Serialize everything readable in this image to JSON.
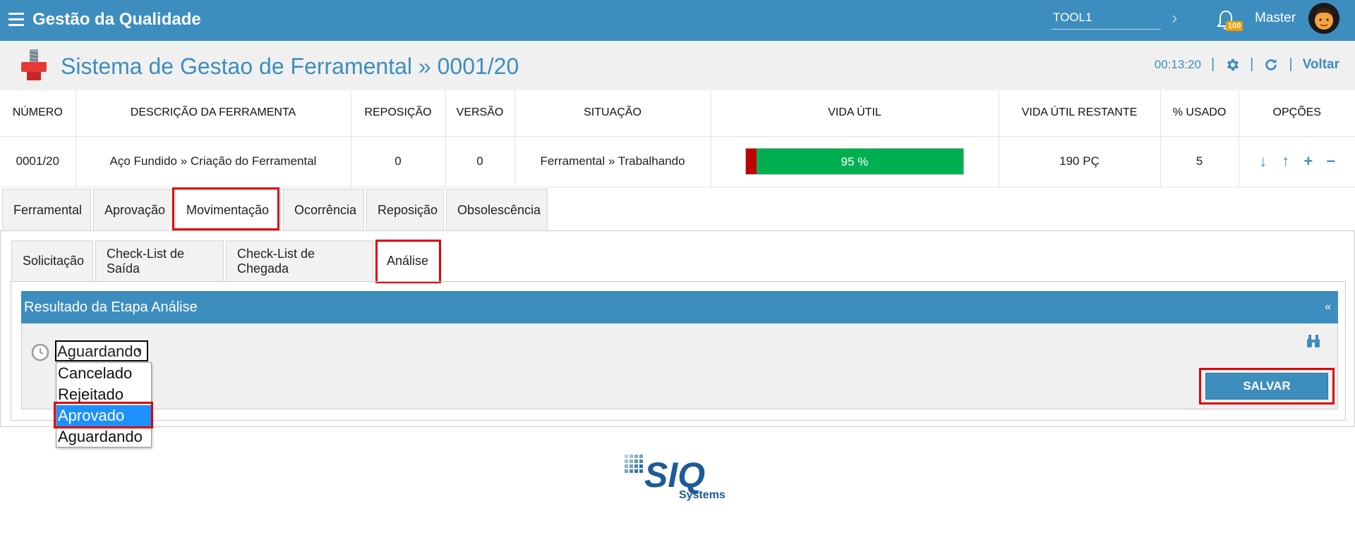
{
  "app": {
    "title": "Gestão da Qualidade"
  },
  "topbar": {
    "search_value": "TOOL1",
    "notifications_count": "100",
    "user_name": "Master"
  },
  "header": {
    "title": "Sistema de Gestao de Ferramental » 0001/20",
    "timer": "00:13:20",
    "back_label": "Voltar"
  },
  "table": {
    "headers": {
      "numero": "NÚMERO",
      "descricao": "DESCRIÇÃO DA FERRAMENTA",
      "reposicao": "REPOSIÇÃO",
      "versao": "VERSÃO",
      "situacao": "SITUAÇÃO",
      "vida_util": "VIDA ÚTIL",
      "vida_restante": "VIDA ÚTIL RESTANTE",
      "usado": "% USADO",
      "opcoes": "OPÇÕES"
    },
    "row": {
      "numero": "0001/20",
      "descricao": "Aço Fundido » Criação do Ferramental",
      "reposicao": "0",
      "versao": "0",
      "situacao": "Ferramental » Trabalhando",
      "vida_util_label": "95 %",
      "vida_util_percent": 95,
      "vida_restante": "190 PÇ",
      "usado": "5"
    },
    "colors": {
      "vida_bar": "#00b050",
      "vida_used": "#c00000"
    }
  },
  "tabs": [
    {
      "label": "Ferramental"
    },
    {
      "label": "Aprovação"
    },
    {
      "label": "Movimentação"
    },
    {
      "label": "Ocorrência"
    },
    {
      "label": "Reposição"
    },
    {
      "label": "Obsolescência"
    }
  ],
  "subtabs": [
    {
      "label": "Solicitação"
    },
    {
      "label": "Check-List de Saída"
    },
    {
      "label": "Check-List de Chegada"
    },
    {
      "label": "Análise"
    }
  ],
  "result": {
    "title": "Resultado da Etapa Análise",
    "collapse_glyph": "«",
    "selected_value": "Aguardando",
    "options": [
      "Cancelado",
      "Rejeitado",
      "Aprovado",
      "Aguardando"
    ],
    "highlighted_option": "Aprovado",
    "save_label": "SALVAR"
  },
  "footer": {
    "logo_text": "SIQ",
    "logo_sub": "Systems"
  },
  "theme": {
    "primary": "#3d8dbf",
    "highlight": "#e00000"
  }
}
